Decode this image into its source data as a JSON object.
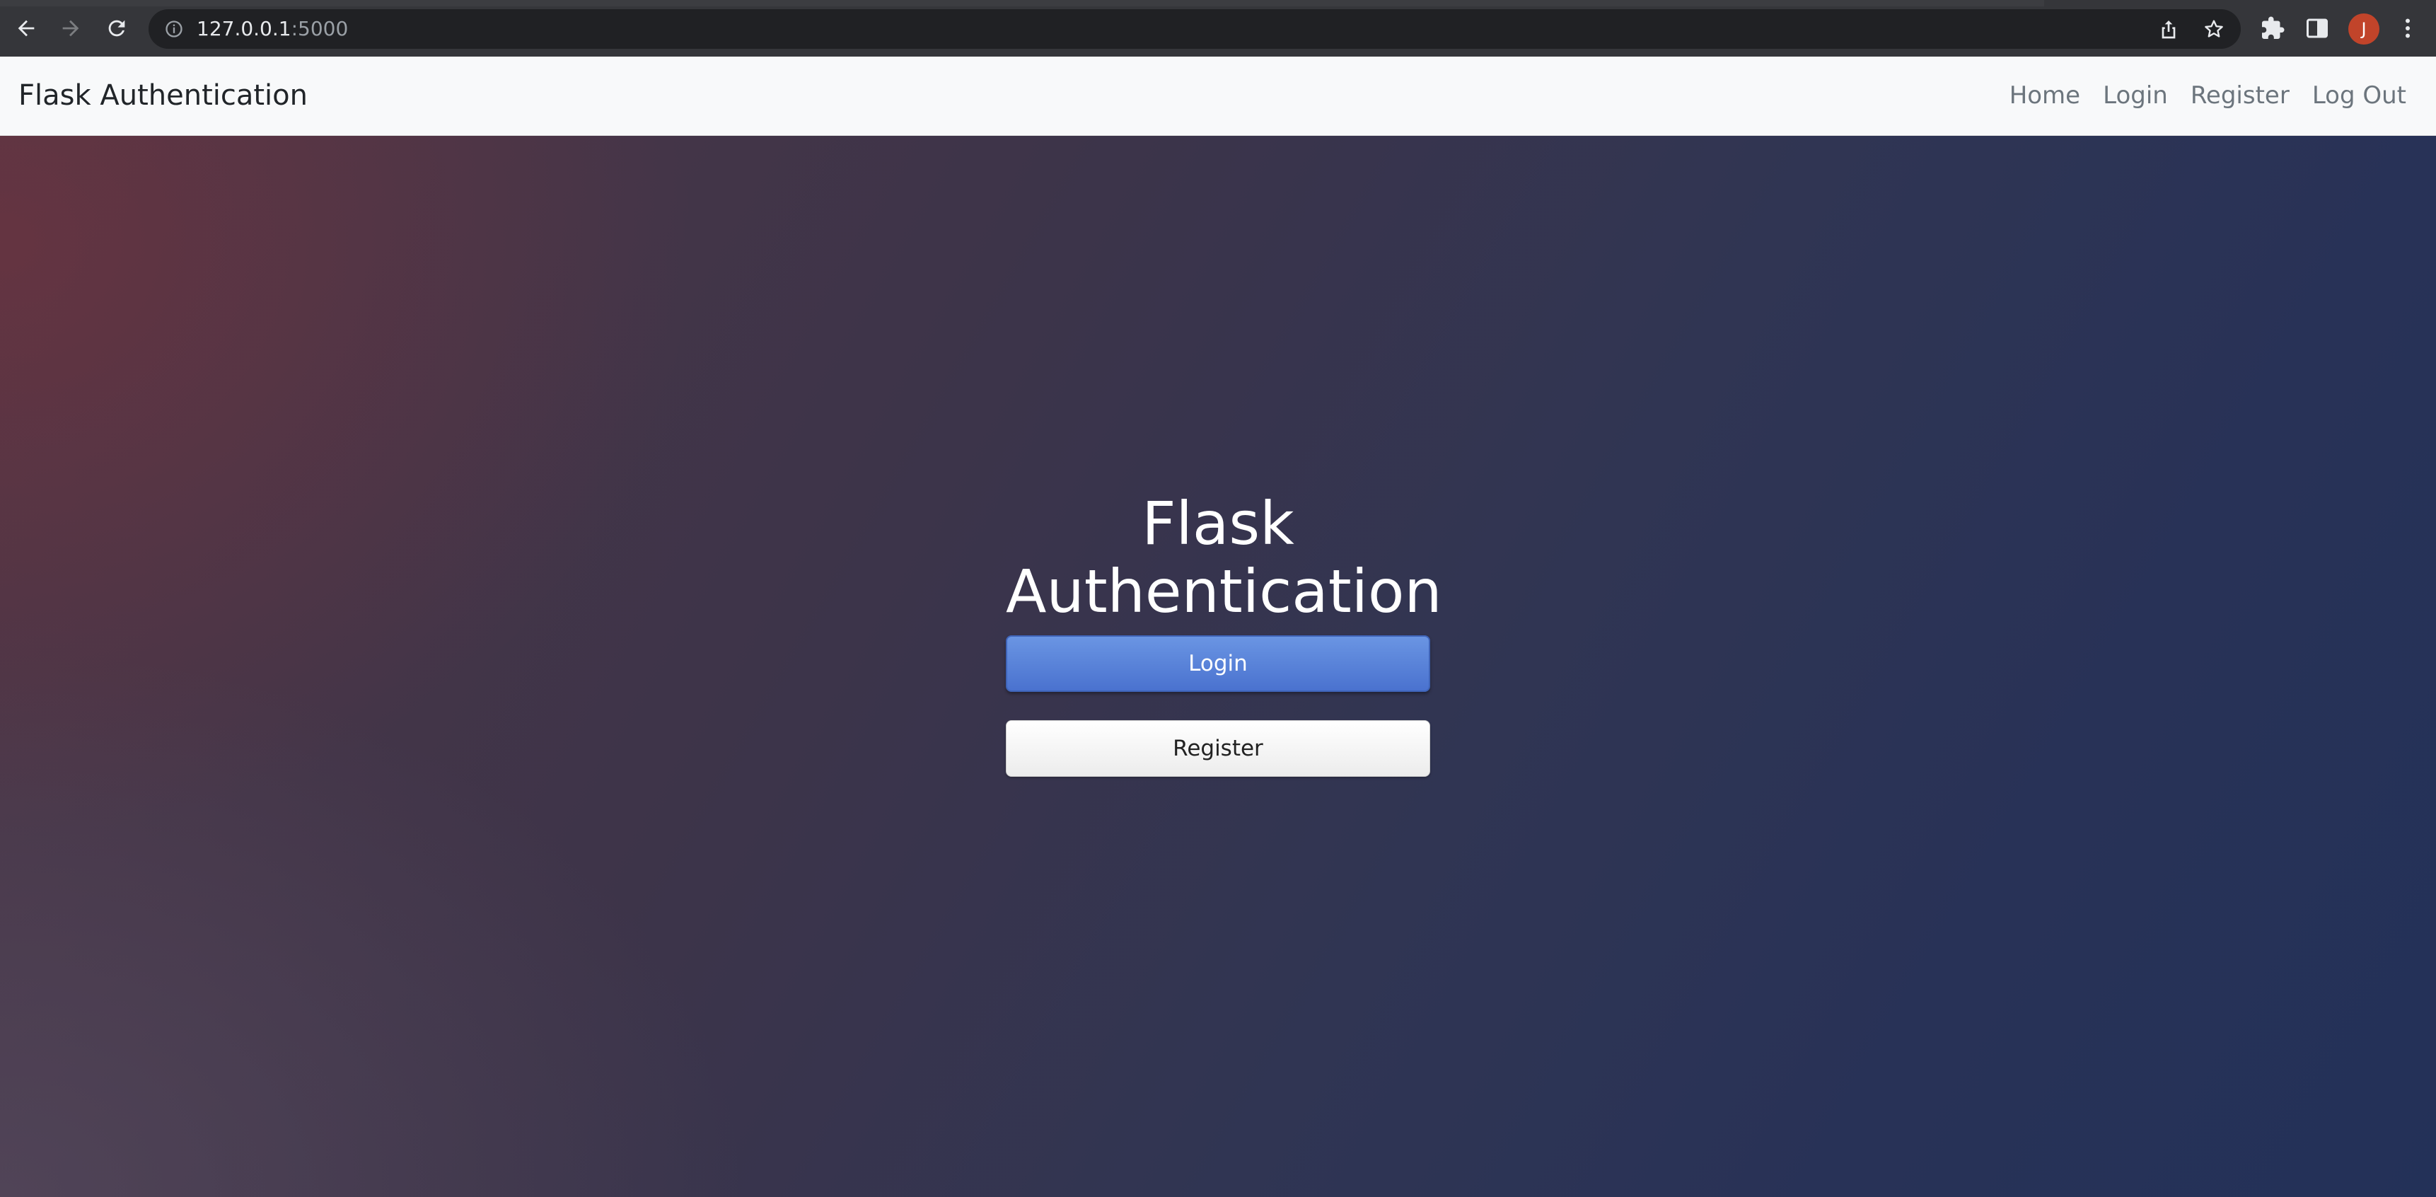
{
  "browser": {
    "url_host": "127.0.0.1",
    "url_port": ":5000",
    "profile_initial": "J",
    "icons": {
      "back": "arrow-left-icon",
      "forward": "arrow-right-icon",
      "reload": "reload-icon",
      "site_info": "info-icon",
      "share": "share-icon",
      "bookmark": "star-icon",
      "extensions": "puzzle-icon",
      "side_panel": "side-panel-icon",
      "menu": "kebab-menu-icon"
    },
    "colors": {
      "toolbar": "#35363a",
      "omnibox": "#202124",
      "avatar": "#c1442a"
    }
  },
  "navbar": {
    "brand": "Flask Authentication",
    "links": [
      {
        "label": "Home"
      },
      {
        "label": "Login"
      },
      {
        "label": "Register"
      },
      {
        "label": "Log Out"
      }
    ]
  },
  "hero": {
    "title_line1": "Flask",
    "title_line2": "Authentication",
    "login_button": "Login",
    "register_button": "Register",
    "colors": {
      "login_button": "#5680d9",
      "register_button": "#ffffff",
      "background_left": "#4e3747",
      "background_right": "#233158"
    }
  }
}
